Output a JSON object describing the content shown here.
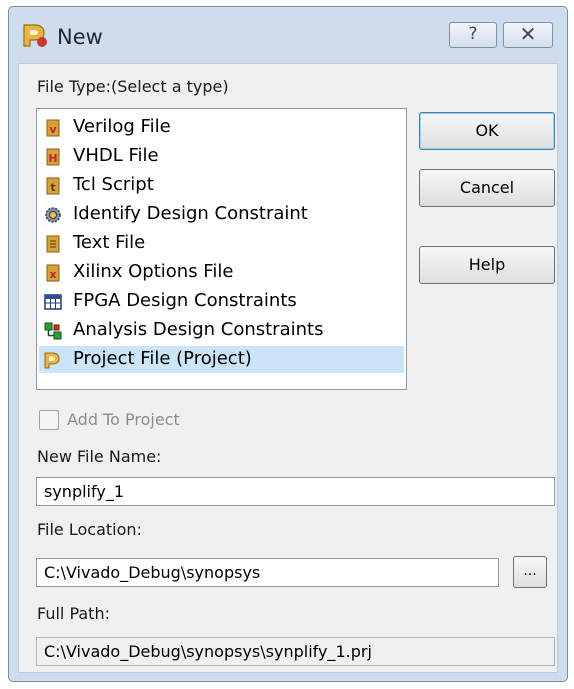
{
  "window": {
    "title": "New",
    "help_glyph": "?",
    "close_glyph": "✕"
  },
  "file_type": {
    "label": "File Type:(Select a type)",
    "items": [
      {
        "label": "Verilog File",
        "icon": "verilog-file-icon"
      },
      {
        "label": "VHDL File",
        "icon": "vhdl-file-icon"
      },
      {
        "label": "Tcl Script",
        "icon": "tcl-script-icon"
      },
      {
        "label": "Identify Design Constraint",
        "icon": "identify-constraint-icon"
      },
      {
        "label": "Text File",
        "icon": "text-file-icon"
      },
      {
        "label": "Xilinx Options File",
        "icon": "xilinx-options-icon"
      },
      {
        "label": "FPGA Design Constraints",
        "icon": "fpga-constraints-icon"
      },
      {
        "label": "Analysis Design Constraints",
        "icon": "analysis-constraints-icon"
      },
      {
        "label": "Project File (Project)",
        "icon": "project-file-icon",
        "selected": true
      }
    ]
  },
  "buttons": {
    "ok": "OK",
    "cancel": "Cancel",
    "help": "Help",
    "browse": "..."
  },
  "add_to_project": {
    "label": "Add To Project",
    "checked": false
  },
  "new_file_name": {
    "label": "New File Name:",
    "value": "synplify_1"
  },
  "file_location": {
    "label": "File Location:",
    "value": "C:\\Vivado_Debug\\synopsys"
  },
  "full_path": {
    "label": "Full Path:",
    "value": "C:\\Vivado_Debug\\synopsys\\synplify_1.prj"
  },
  "colors": {
    "title_bar": "#cfdcec",
    "selection": "#cce4f7",
    "icon_red": "#b8262b",
    "icon_gold": "#d8a23b"
  }
}
